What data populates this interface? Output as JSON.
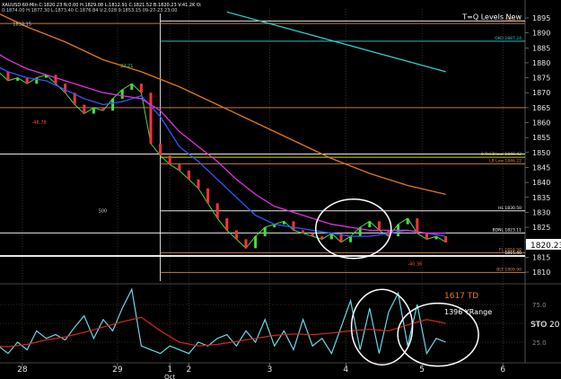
{
  "header": {
    "symbol_line": "XAUUSD 60-Min C:1820.23 N:0.00 H:1829.08 L:1812.91 C:1821.52 B:1820.23 V:41.2K O:",
    "line2": "0:1874.00 H:1877.30 L:1873.40 C:1876.84 V:2,028 9:1853.15 09-27-23 23:00"
  },
  "chart_data": [
    {
      "type": "line",
      "panel": "price",
      "ylim": [
        1807,
        1898
      ],
      "yticks": [
        1810,
        1815,
        1820,
        1825,
        1830,
        1835,
        1840,
        1845,
        1850,
        1855,
        1860,
        1865,
        1870,
        1875,
        1880,
        1885,
        1890,
        1895
      ],
      "last_price": "1820.23",
      "x_ticks": [
        {
          "x": 1.5,
          "label": "28"
        },
        {
          "x": 11.5,
          "label": "29"
        },
        {
          "x": 17.0,
          "label": "1"
        },
        {
          "x": 19.0,
          "label": "2"
        },
        {
          "x": 27.5,
          "label": "3"
        },
        {
          "x": 35.5,
          "label": "4"
        },
        {
          "x": 43.5,
          "label": "5"
        },
        {
          "x": 52.0,
          "label": "6"
        }
      ],
      "month_label": {
        "x": 17.0,
        "label": "Oct"
      },
      "series": [
        {
          "role": "price",
          "color": "#44dd44",
          "x": [
            -2,
            -1,
            0,
            1,
            2,
            3,
            4,
            5,
            6,
            7,
            8,
            9,
            10,
            11,
            12,
            13,
            14,
            15,
            16,
            17,
            18,
            19,
            20,
            21,
            22,
            23,
            24,
            25,
            26,
            27,
            28,
            29,
            30,
            31,
            32,
            33,
            34,
            35,
            36,
            37,
            38,
            39,
            40,
            41,
            42,
            43,
            44,
            45,
            46
          ],
          "values": [
            1870,
            1877,
            1874,
            1875,
            1873,
            1875,
            1876,
            1873,
            1870,
            1866,
            1863,
            1865,
            1864,
            1868,
            1871,
            1873,
            1870,
            1853,
            1849,
            1846,
            1844,
            1841,
            1838,
            1833,
            1828,
            1824,
            1821,
            1818,
            1822,
            1825,
            1826,
            1827,
            1824,
            1823,
            1822,
            1821,
            1823,
            1820,
            1822,
            1825,
            1827,
            1824,
            1822,
            1826,
            1828,
            1823,
            1821,
            1822,
            1820
          ]
        },
        {
          "role": "ema-fast",
          "color": "#3355ff",
          "x": [
            -2,
            0,
            2,
            4,
            6,
            8,
            10,
            12,
            14,
            16,
            18,
            20,
            22,
            24,
            26,
            28,
            30,
            32,
            34,
            36,
            38,
            40,
            42,
            44,
            46
          ],
          "values": [
            1880,
            1877,
            1875,
            1874,
            1871,
            1868,
            1866,
            1867,
            1869,
            1862,
            1852,
            1847,
            1841,
            1835,
            1829,
            1826,
            1825,
            1824,
            1823,
            1822,
            1822,
            1823,
            1824,
            1823,
            1822
          ]
        },
        {
          "role": "ema-mid",
          "color": "#dd33dd",
          "x": [
            -2,
            0,
            2,
            4,
            6,
            8,
            10,
            12,
            14,
            16,
            18,
            20,
            22,
            24,
            26,
            28,
            30,
            32,
            34,
            36,
            38,
            40,
            42,
            44,
            46
          ],
          "values": [
            1885,
            1881,
            1878,
            1876,
            1874,
            1872,
            1870,
            1869,
            1868,
            1864,
            1857,
            1852,
            1847,
            1841,
            1836,
            1832,
            1830,
            1828,
            1826,
            1825,
            1824,
            1824,
            1824,
            1823,
            1823
          ]
        },
        {
          "role": "ema-slow",
          "color": "#e07a1a",
          "x": [
            -2,
            2,
            6,
            10,
            14,
            18,
            22,
            26,
            30,
            34,
            38,
            42,
            46
          ],
          "values": [
            1898,
            1892,
            1887,
            1881,
            1877,
            1872,
            1866,
            1860,
            1854,
            1848,
            1843,
            1839,
            1836
          ]
        },
        {
          "role": "trend",
          "color": "#33cccc",
          "x": [
            23,
            46
          ],
          "values": [
            1897,
            1877
          ]
        }
      ],
      "levels": [
        {
          "label": "T=Q Levels New",
          "value": 1894,
          "color": "#ffffff",
          "x_from": 16
        },
        {
          "label": "OKO 1887.24",
          "value": 1887.24,
          "color": "#33cccc",
          "x_from": 16
        },
        {
          "label": "1893.15",
          "value": 1893.15,
          "color": "#d88a4a",
          "x_from": -2
        },
        {
          "label": "0 Rel3Hour 1848.42",
          "value": 1848.42,
          "color": "#e6e600",
          "x_from": 16
        },
        {
          "label": "LB Low 1846.22",
          "value": 1846.22,
          "color": "#d88a4a",
          "x_from": 16
        },
        {
          "label": "HL 1830.50",
          "value": 1830.5,
          "color": "#ffffff",
          "x_from": 16
        },
        {
          "label": "BDNL 1823.11",
          "value": 1823.11,
          "color": "#ffffff",
          "x_from": -2
        },
        {
          "label": "FL 1816.50",
          "value": 1816.5,
          "color": "#d88a4a",
          "x_from": 16
        },
        {
          "label": "1815.40",
          "value": 1815.4,
          "color": "#ffffff",
          "x_from": -2
        },
        {
          "label": "BLT 1809.90",
          "value": 1809.9,
          "color": "#d88a4a",
          "x_from": 16
        },
        {
          "label": "",
          "value": 1865,
          "color": "#d88a4a",
          "x_from": -2
        },
        {
          "label": "",
          "value": 1849.5,
          "color": "#ffffff",
          "x_from": -2
        }
      ],
      "annotations": [
        {
          "text": "-48.78",
          "x": 2.5,
          "value": 1859.5,
          "color": "#ff4444"
        },
        {
          "text": "22.21",
          "x": 11.8,
          "value": 1878.5,
          "color": "#44dd44"
        },
        {
          "text": "500",
          "x": 9.5,
          "value": 1830,
          "color": "#cccccc"
        },
        {
          "text": "-40.36",
          "x": 42.0,
          "value": 1812.2,
          "color": "#ff4444"
        },
        {
          "text": "1833.15",
          "x": 0.5,
          "value": 1892.5,
          "color": "#cccccc"
        }
      ]
    },
    {
      "type": "line",
      "panel": "oscillator",
      "ylim": [
        0,
        100
      ],
      "yticks": [
        25,
        50,
        75
      ],
      "label": "STO",
      "value_label": "20",
      "text_1617": "1617 TD",
      "text_yrange": "1396 YRange",
      "series": [
        {
          "role": "stoch-k",
          "color": "#66d9e8",
          "x": [
            -2,
            -1,
            0,
            1,
            2,
            3,
            4,
            5,
            6,
            7,
            8,
            9,
            10,
            11,
            12,
            13,
            14,
            15,
            16,
            17,
            18,
            19,
            20,
            21,
            22,
            23,
            24,
            25,
            26,
            27,
            28,
            29,
            30,
            31,
            32,
            33,
            34,
            35,
            36,
            37,
            38,
            39,
            40,
            41,
            42,
            43,
            44,
            45,
            46
          ],
          "values": [
            12,
            20,
            10,
            25,
            15,
            40,
            30,
            35,
            28,
            45,
            60,
            30,
            55,
            40,
            70,
            95,
            20,
            15,
            10,
            20,
            15,
            10,
            25,
            20,
            30,
            35,
            20,
            40,
            25,
            55,
            20,
            40,
            15,
            55,
            20,
            30,
            10,
            45,
            80,
            15,
            70,
            10,
            65,
            90,
            20,
            75,
            10,
            30,
            25
          ]
        },
        {
          "role": "stoch-d",
          "color": "#dd2222",
          "x": [
            -2,
            0,
            2,
            4,
            6,
            8,
            10,
            12,
            14,
            16,
            18,
            20,
            22,
            24,
            26,
            28,
            30,
            32,
            34,
            36,
            38,
            40,
            42,
            44,
            46
          ],
          "values": [
            20,
            19,
            22,
            28,
            32,
            38,
            45,
            52,
            58,
            40,
            25,
            20,
            22,
            26,
            30,
            34,
            36,
            35,
            37,
            40,
            42,
            40,
            48,
            55,
            50
          ]
        }
      ]
    }
  ],
  "colors": {
    "background": "#000000",
    "grid": "#6b5a3a",
    "axis_text": "#e6e6e6",
    "circle": "#ffffff",
    "price_label_bg": "#ffffff"
  }
}
